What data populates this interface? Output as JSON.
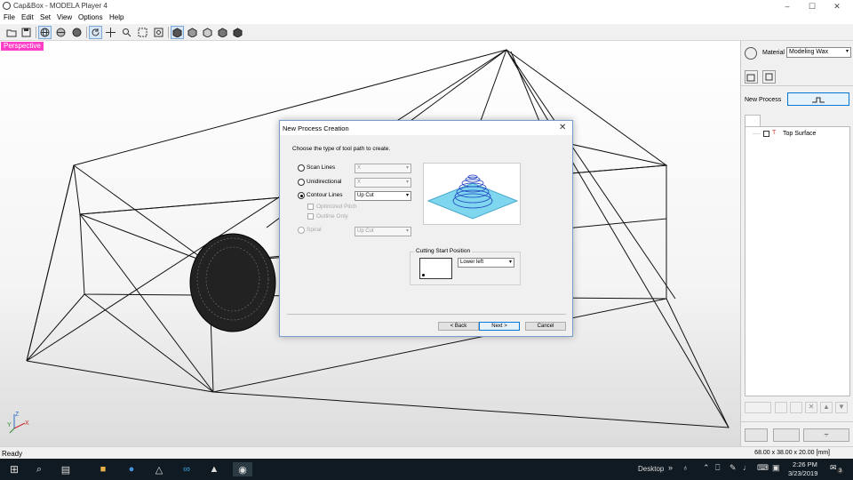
{
  "window": {
    "title": "Cap&Box - MODELA Player 4",
    "min_icon": "minimize-icon",
    "max_icon": "maximize-icon",
    "close_icon": "close-icon"
  },
  "menu": [
    "File",
    "Edit",
    "Set",
    "View",
    "Options",
    "Help"
  ],
  "toolbar": {
    "icons": [
      "open-file-icon",
      "save-icon",
      "wireframe-sphere-icon",
      "mesh-sphere-icon",
      "shaded-sphere-icon",
      "rotate-icon",
      "pan-icon",
      "zoom-icon",
      "fit-icon",
      "zoom-window-icon",
      "view-iso-icon",
      "view-top-icon",
      "view-front-icon",
      "view-right-icon",
      "view-back-icon"
    ]
  },
  "viewport": {
    "label": "Perspective"
  },
  "right_panel": {
    "material_label": "Material",
    "material_value": "Modeling Wax",
    "new_process_label": "New Process",
    "tree": [
      {
        "label": "Top Surface"
      }
    ]
  },
  "status": {
    "text": "Ready",
    "dimensions": "68.00 x 38.00 x 20.00 [mm]"
  },
  "taskbar": {
    "desktop_label": "Desktop",
    "time": "2:26 PM",
    "date": "3/23/2019",
    "notification_count": "3"
  },
  "dialog": {
    "title": "New Process Creation",
    "prompt": "Choose the type of tool path to create.",
    "options": [
      {
        "label": "Scan Lines",
        "selected": false,
        "enabled": true,
        "combo": "X",
        "combo_enabled": false
      },
      {
        "label": "Unidirectional",
        "selected": false,
        "enabled": true,
        "combo": "X",
        "combo_enabled": false
      },
      {
        "label": "Contour Lines",
        "selected": true,
        "enabled": true,
        "combo": "Up Cut",
        "combo_enabled": true
      },
      {
        "label": "Spiral",
        "selected": false,
        "enabled": false,
        "combo": "Up Cut",
        "combo_enabled": false
      }
    ],
    "checkboxes": [
      {
        "label": "Optimized Pitch",
        "checked": false
      },
      {
        "label": "Outline Only",
        "checked": false
      }
    ],
    "cutting_start": {
      "label": "Cutting Start Position",
      "value": "Lower left"
    },
    "buttons": {
      "back": "< Back",
      "next": "Next >",
      "cancel": "Cancel"
    }
  }
}
